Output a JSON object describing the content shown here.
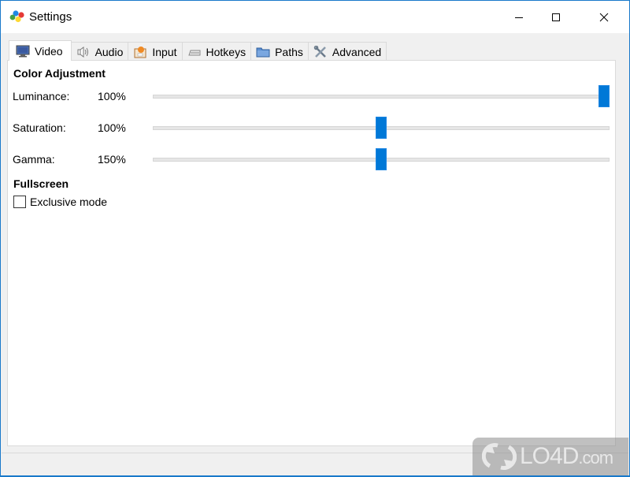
{
  "window": {
    "title": "Settings",
    "app_icon": "colored-dots-logo-icon",
    "controls": [
      {
        "name": "minimize",
        "icon": "minimize-icon"
      },
      {
        "name": "maximize",
        "icon": "maximize-icon"
      },
      {
        "name": "close",
        "icon": "close-icon"
      }
    ]
  },
  "tabs": [
    {
      "label": "Video",
      "icon": "monitor-icon",
      "active": true
    },
    {
      "label": "Audio",
      "icon": "speaker-icon",
      "active": false
    },
    {
      "label": "Input",
      "icon": "input-icon",
      "active": false
    },
    {
      "label": "Hotkeys",
      "icon": "keyboard-icon",
      "active": false
    },
    {
      "label": "Paths",
      "icon": "folder-icon",
      "active": false
    },
    {
      "label": "Advanced",
      "icon": "tools-icon",
      "active": false
    }
  ],
  "video": {
    "color_adjustment": {
      "title": "Color Adjustment",
      "rows": [
        {
          "label": "Luminance:",
          "value": "100%",
          "slider_fraction": 1.0
        },
        {
          "label": "Saturation:",
          "value": "100%",
          "slider_fraction": 0.5
        },
        {
          "label": "Gamma:",
          "value": "150%",
          "slider_fraction": 0.5
        }
      ]
    },
    "fullscreen": {
      "title": "Fullscreen",
      "exclusive_mode": {
        "label": "Exclusive mode",
        "checked": false
      }
    }
  },
  "watermark": {
    "text": "LO4D",
    "suffix": ".com"
  },
  "colors": {
    "accent": "#0078d7",
    "window_border": "#1979ca"
  }
}
